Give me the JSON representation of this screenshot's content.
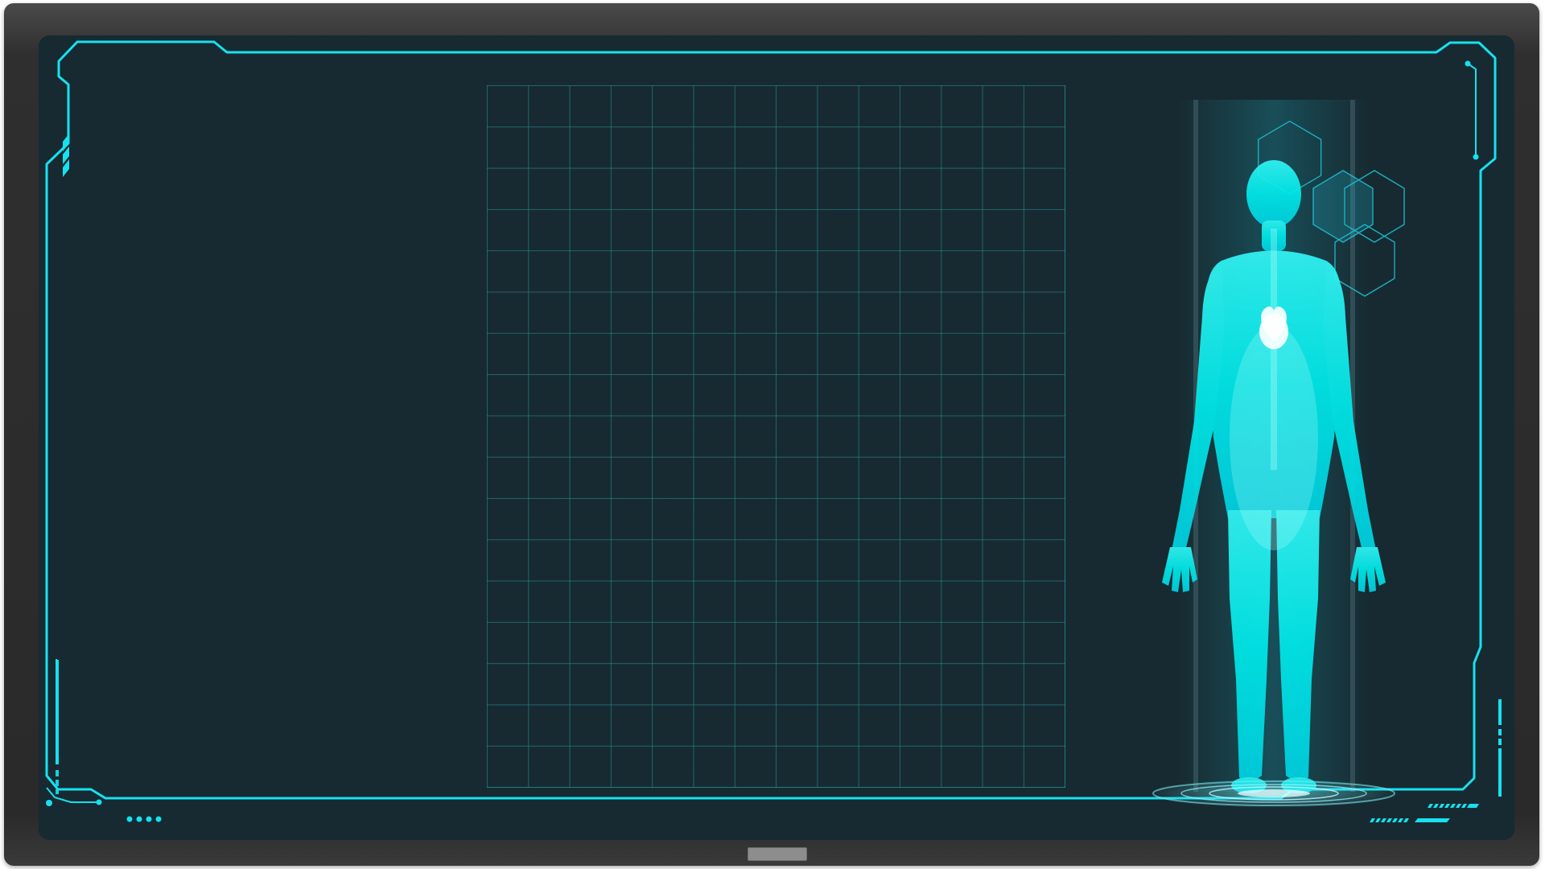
{
  "device": {
    "type": "wall-mounted display",
    "bezel_color": "#2a2a2a",
    "home_indicator_icon": "home-indicator"
  },
  "screen": {
    "background": "#172a31",
    "accent_color": "#16e1f0",
    "frame_icon": "hud-frame",
    "decor": {
      "left_stripes_icon": "stripe-pattern-icon",
      "bottom_dots_icon": "dots-icon",
      "right_dashes_icon": "dash-pattern-icon"
    }
  },
  "grid": {
    "columns": 14,
    "rows": 17,
    "line_color": "#2a8f96"
  },
  "hologram": {
    "icon": "human-body-hologram-icon",
    "organ_icon": "heart-icon",
    "hexagons_icon": "hexagon-cluster-icon",
    "platform_icon": "projector-base-icon",
    "body_color": "#00f2f2",
    "glow_color": "#1fd0e6"
  }
}
